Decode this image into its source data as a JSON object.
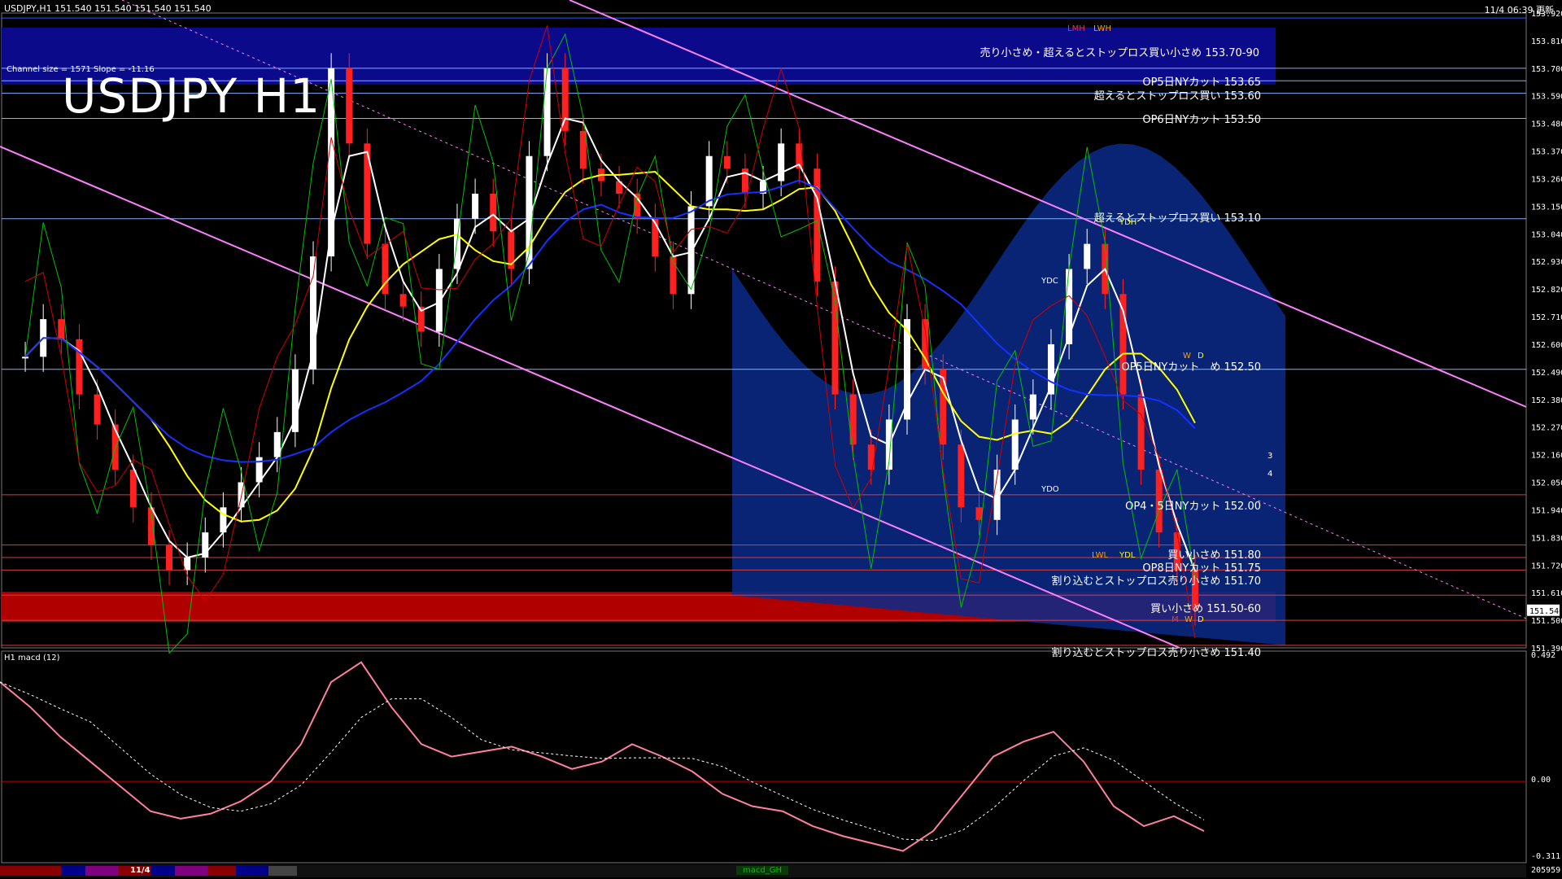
{
  "header": {
    "symbol_info": "USDJPY,H1  151.540 151.540 151.540 151.540",
    "datetime": "11/4 06:39 更新",
    "channel_info": "Channel size = 1571 Slope = -11.16",
    "big_title": "USDJPY H1"
  },
  "colors": {
    "background": "#000000",
    "blue_band": "#0a0a8a",
    "red_band": "#b00000",
    "cloud": "#0a2a8a",
    "white_ma": "#ffffff",
    "yellow_ma": "#ffff00",
    "blue_ma": "#1530ff",
    "green_line": "#00c000",
    "red_line": "#d00000",
    "pink_channel": "#ff80ff",
    "macd_main": "#ff80a0",
    "macd_green": "#00ff00"
  },
  "annotations": {
    "sell_band": "売り小さめ・超えるとストップロス買い小さめ 153.70-90",
    "op5_cut_1": "OP5日NYカット 153.65",
    "stop_buy_1": "超えるとストップロス買い 153.60",
    "op6_cut": "OP6日NYカット 153.50",
    "stop_buy_2": "超えるとストップロス買い 153.10",
    "op5_cut_2": "OP5日NYカット　め 152.50",
    "op45_cut": "OP4・5日NYカット 152.00",
    "buy_small": "買い小さめ 151.80",
    "op8_cut": "OP8日NYカット 151.75",
    "stop_sell": "割り込むとストップロス売り小さめ 151.70",
    "buy_band": "買い小さめ 151.50-60",
    "stop_sell_2": "割り込むとストップロス売り小さめ 151.40"
  },
  "box_labels": {
    "lmh": "LMH",
    "lwh": "LWH",
    "ydh": "YDH",
    "ydc": "YDC",
    "ydo": "YDO",
    "lwl": "LWL",
    "ydl": "YDL",
    "w1": "W",
    "d1": "D",
    "m2": "M",
    "w2": "W",
    "d2": "D",
    "n3": "3",
    "n4": "4"
  },
  "macd": {
    "label": "H1  macd (12)",
    "top_value": "0.492",
    "zero_value": "0.00",
    "bottom_value": "-0.311",
    "footer_value": "205959",
    "footer_tag": "macd_GH",
    "date_tag": "11/4"
  },
  "current_price_label": "151.540",
  "chart_data": {
    "type": "line",
    "title": "USDJPY H1",
    "y_ticks": [
      "153.920",
      "153.810",
      "153.700",
      "153.590",
      "153.480",
      "153.370",
      "153.260",
      "153.150",
      "153.040",
      "152.930",
      "152.820",
      "152.710",
      "152.600",
      "152.490",
      "152.380",
      "152.270",
      "152.160",
      "152.050",
      "151.940",
      "151.830",
      "151.720",
      "151.610",
      "151.500",
      "151.390"
    ],
    "ylim": [
      151.39,
      153.92
    ],
    "close_series": [
      152.55,
      152.7,
      152.62,
      152.4,
      152.28,
      152.1,
      151.95,
      151.8,
      151.7,
      151.75,
      151.85,
      151.95,
      152.05,
      152.15,
      152.25,
      152.5,
      152.95,
      153.7,
      153.4,
      153.0,
      152.8,
      152.75,
      152.65,
      152.9,
      153.1,
      153.2,
      153.05,
      152.9,
      153.35,
      153.7,
      153.45,
      153.3,
      153.25,
      153.2,
      153.1,
      152.95,
      152.8,
      153.15,
      153.35,
      153.3,
      153.2,
      153.25,
      153.4,
      153.3,
      152.85,
      152.4,
      152.2,
      152.1,
      152.3,
      152.7,
      152.5,
      152.2,
      151.95,
      151.9,
      152.1,
      152.3,
      152.4,
      152.6,
      152.9,
      153.0,
      152.8,
      152.4,
      152.1,
      151.85,
      151.7,
      151.54
    ],
    "levels": [
      153.9,
      153.7,
      153.65,
      153.6,
      153.5,
      153.1,
      152.5,
      152.0,
      151.8,
      151.75,
      151.7,
      151.6,
      151.5,
      151.4
    ],
    "macd_values": [
      0.4,
      0.3,
      0.18,
      0.08,
      -0.02,
      -0.12,
      -0.15,
      -0.13,
      -0.08,
      0.0,
      0.15,
      0.4,
      0.48,
      0.3,
      0.15,
      0.1,
      0.12,
      0.14,
      0.1,
      0.05,
      0.08,
      0.15,
      0.1,
      0.04,
      -0.05,
      -0.1,
      -0.12,
      -0.18,
      -0.22,
      -0.25,
      -0.28,
      -0.2,
      -0.05,
      0.1,
      0.16,
      0.2,
      0.08,
      -0.1,
      -0.18,
      -0.14,
      -0.2
    ],
    "macd_ylim": [
      -0.311,
      0.492
    ]
  }
}
